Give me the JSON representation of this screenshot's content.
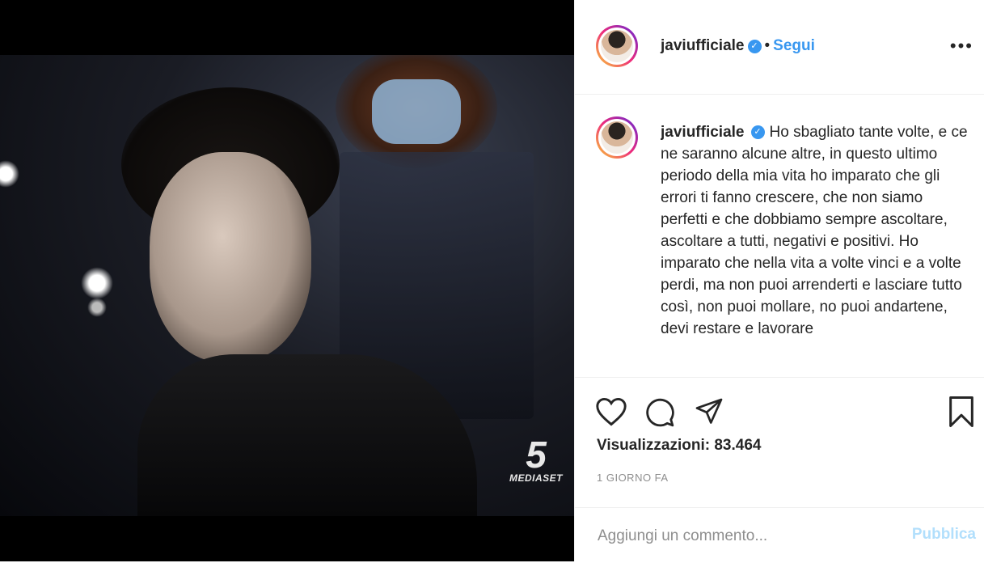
{
  "post": {
    "username": "javiufficiale",
    "follow_label": "Segui",
    "more_label": "•••",
    "caption": "Ho sbagliato tante volte, e ce ne saranno alcune altre, in questo ultimo periodo della mia vita ho imparato che gli errori ti fanno crescere, che non siamo perfetti e che dobbiamo sempre ascoltare, ascoltare a tutti, negativi e positivi. Ho imparato che nella vita a volte vinci e a volte perdi, ma non puoi arrenderti e lasciare tutto così, non puoi mollare, no puoi andartene, devi restare e lavorare",
    "views_label": "Visualizzazioni: 83.464",
    "time_label": "1 GIORNO FA"
  },
  "comment": {
    "placeholder": "Aggiungi un commento...",
    "publish_label": "Pubblica"
  },
  "video": {
    "channel_number": "5",
    "channel_name": "MEDIASET"
  },
  "icons": [
    "heart-icon",
    "comment-icon",
    "share-icon",
    "bookmark-icon",
    "verified-icon"
  ],
  "colors": {
    "accent": "#3897f0",
    "publish_disabled": "#b2dffc",
    "text": "#262626",
    "muted": "#8e8e8e"
  }
}
